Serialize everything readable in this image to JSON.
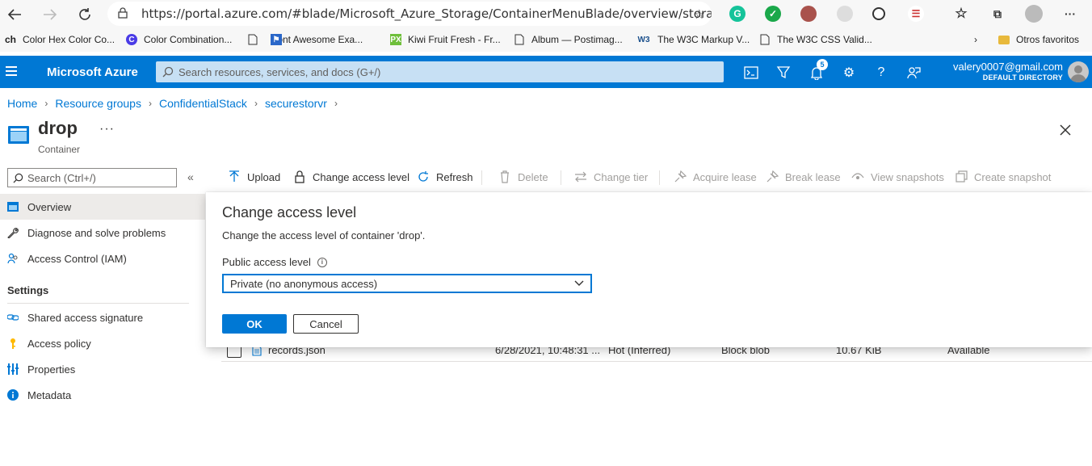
{
  "browser": {
    "url": "https://portal.azure.com/#blade/Microsoft_Azure_Storage/ContainerMenuBlade/overview/storageAccount...",
    "bookmarks": [
      {
        "label": "Color Hex Color Co...",
        "icon": "ch"
      },
      {
        "label": "Color Combination...",
        "icon": "C"
      },
      {
        "label": "Font Awesome Exa...",
        "icon": "page"
      },
      {
        "label": "Kiwi Fruit Fresh - Fr...",
        "icon": "PX"
      },
      {
        "label": "Album — Postimag...",
        "icon": "page"
      },
      {
        "label": "The W3C Markup V...",
        "icon": "W3"
      },
      {
        "label": "The W3C CSS Valid...",
        "icon": "page"
      }
    ],
    "other_favorites": "Otros favoritos"
  },
  "azure": {
    "brand": "Microsoft Azure",
    "search_placeholder": "Search resources, services, and docs (G+/)",
    "notifications_count": "5",
    "user_email": "valery0007@gmail.com",
    "user_directory": "DEFAULT DIRECTORY"
  },
  "breadcrumb": [
    "Home",
    "Resource groups",
    "ConfidentialStack",
    "securestorvr"
  ],
  "page": {
    "title": "drop",
    "subtitle": "Container",
    "more": "···"
  },
  "sidebar": {
    "search_placeholder": "Search (Ctrl+/)",
    "collapse": "«",
    "items": [
      {
        "label": "Overview",
        "icon": "container-icon"
      },
      {
        "label": "Diagnose and solve problems",
        "icon": "wrench-icon"
      },
      {
        "label": "Access Control (IAM)",
        "icon": "people-icon"
      }
    ],
    "settings_heading": "Settings",
    "settings_items": [
      {
        "label": "Shared access signature",
        "icon": "link-icon"
      },
      {
        "label": "Access policy",
        "icon": "key-icon"
      },
      {
        "label": "Properties",
        "icon": "properties-icon"
      },
      {
        "label": "Metadata",
        "icon": "info-icon"
      }
    ]
  },
  "toolbar": {
    "upload": "Upload",
    "change_access_level": "Change access level",
    "refresh": "Refresh",
    "delete": "Delete",
    "change_tier": "Change tier",
    "acquire_lease": "Acquire lease",
    "break_lease": "Break lease",
    "view_snapshots": "View snapshots",
    "create_snapshot": "Create snapshot"
  },
  "blob_row": {
    "name": "records.json",
    "modified": "6/28/2021, 10:48:31 ...",
    "tier": "Hot (Inferred)",
    "type": "Block blob",
    "size": "10.67 KiB",
    "lease": "Available",
    "more": "···"
  },
  "dialog": {
    "title": "Change access level",
    "description": "Change the access level of container 'drop'.",
    "field_label": "Public access level",
    "selected_value": "Private (no anonymous access)",
    "ok": "OK",
    "cancel": "Cancel"
  },
  "colors": {
    "azure_blue": "#0078d4",
    "search_bg": "#c7e0f4",
    "active_nav": "#edebe9"
  }
}
